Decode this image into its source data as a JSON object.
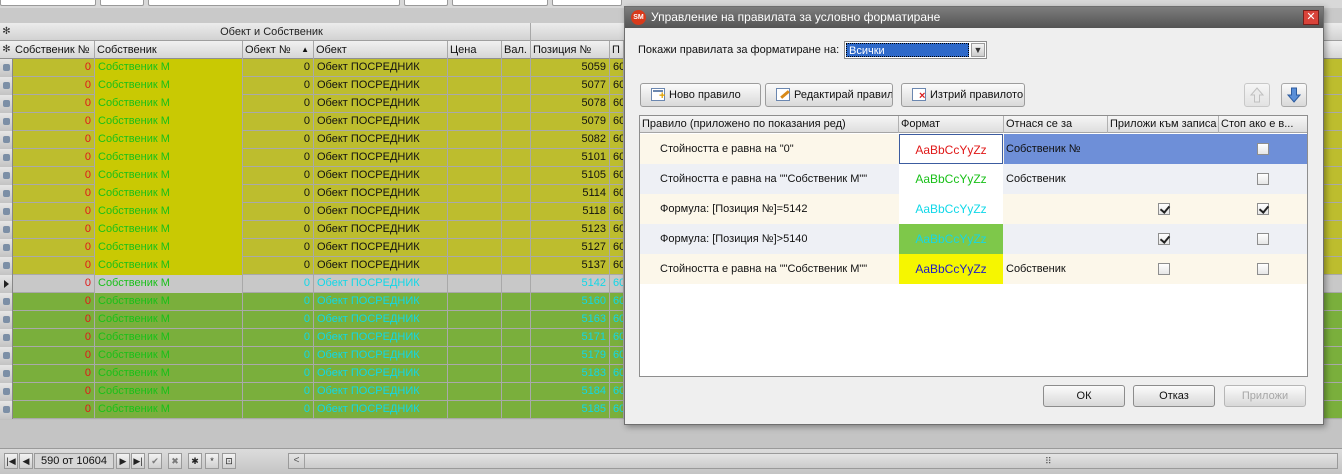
{
  "grid": {
    "group_header": "Обект и Собственик",
    "columns": [
      "Собственик №",
      "Собственик",
      "Обект №",
      "Обект",
      "Цена",
      "Вал.",
      "Позиция №",
      "П"
    ],
    "rows": [
      {
        "owner_no": "0",
        "owner": "Собственик М",
        "object_no": "0",
        "object": "Обект ПОСРЕДНИК",
        "position": "5059",
        "trail": "60",
        "style": "yellow"
      },
      {
        "owner_no": "0",
        "owner": "Собственик М",
        "object_no": "0",
        "object": "Обект ПОСРЕДНИК",
        "position": "5077",
        "trail": "60",
        "style": "yellow"
      },
      {
        "owner_no": "0",
        "owner": "Собственик М",
        "object_no": "0",
        "object": "Обект ПОСРЕДНИК",
        "position": "5078",
        "trail": "60",
        "style": "yellow"
      },
      {
        "owner_no": "0",
        "owner": "Собственик М",
        "object_no": "0",
        "object": "Обект ПОСРЕДНИК",
        "position": "5079",
        "trail": "60",
        "style": "yellow"
      },
      {
        "owner_no": "0",
        "owner": "Собственик М",
        "object_no": "0",
        "object": "Обект ПОСРЕДНИК",
        "position": "5082",
        "trail": "60",
        "style": "yellow"
      },
      {
        "owner_no": "0",
        "owner": "Собственик М",
        "object_no": "0",
        "object": "Обект ПОСРЕДНИК",
        "position": "5101",
        "trail": "60",
        "style": "yellow"
      },
      {
        "owner_no": "0",
        "owner": "Собственик М",
        "object_no": "0",
        "object": "Обект ПОСРЕДНИК",
        "position": "5105",
        "trail": "60",
        "style": "yellow"
      },
      {
        "owner_no": "0",
        "owner": "Собственик М",
        "object_no": "0",
        "object": "Обект ПОСРЕДНИК",
        "position": "5114",
        "trail": "60",
        "style": "yellow"
      },
      {
        "owner_no": "0",
        "owner": "Собственик М",
        "object_no": "0",
        "object": "Обект ПОСРЕДНИК",
        "position": "5118",
        "trail": "60",
        "style": "yellow"
      },
      {
        "owner_no": "0",
        "owner": "Собственик М",
        "object_no": "0",
        "object": "Обект ПОСРЕДНИК",
        "position": "5123",
        "trail": "60",
        "style": "yellow"
      },
      {
        "owner_no": "0",
        "owner": "Собственик М",
        "object_no": "0",
        "object": "Обект ПОСРЕДНИК",
        "position": "5127",
        "trail": "60",
        "style": "yellow"
      },
      {
        "owner_no": "0",
        "owner": "Собственик М",
        "object_no": "0",
        "object": "Обект ПОСРЕДНИК",
        "position": "5137",
        "trail": "60",
        "style": "yellow"
      },
      {
        "owner_no": "0",
        "owner": "Собственик М",
        "object_no": "0",
        "object": "Обект ПОСРЕДНИК",
        "position": "5142",
        "trail": "60",
        "style": "current"
      },
      {
        "owner_no": "0",
        "owner": "Собственик М",
        "object_no": "0",
        "object": "Обект ПОСРЕДНИК",
        "position": "5160",
        "trail": "60",
        "style": "green"
      },
      {
        "owner_no": "0",
        "owner": "Собственик М",
        "object_no": "0",
        "object": "Обект ПОСРЕДНИК",
        "position": "5163",
        "trail": "60",
        "style": "green"
      },
      {
        "owner_no": "0",
        "owner": "Собственик М",
        "object_no": "0",
        "object": "Обект ПОСРЕДНИК",
        "position": "5171",
        "trail": "60",
        "style": "green"
      },
      {
        "owner_no": "0",
        "owner": "Собственик М",
        "object_no": "0",
        "object": "Обект ПОСРЕДНИК",
        "position": "5179",
        "trail": "60",
        "style": "green"
      },
      {
        "owner_no": "0",
        "owner": "Собственик М",
        "object_no": "0",
        "object": "Обект ПОСРЕДНИК",
        "position": "5183",
        "trail": "60",
        "style": "green"
      },
      {
        "owner_no": "0",
        "owner": "Собственик М",
        "object_no": "0",
        "object": "Обект ПОСРЕДНИК",
        "position": "5184",
        "trail": "60",
        "style": "green"
      },
      {
        "owner_no": "0",
        "owner": "Собственик М",
        "object_no": "0",
        "object": "Обект ПОСРЕДНИК",
        "position": "5185",
        "trail": "60",
        "style": "green"
      }
    ]
  },
  "navigator": {
    "counter": "590 от 10604",
    "buttons": [
      "first-icon",
      "prev-icon",
      "next-icon",
      "last-icon",
      "post-icon",
      "cancel-icon",
      "insert-icon",
      "edit-icon",
      "filter-icon"
    ]
  },
  "dialog": {
    "title": "Управление на правилата за условно форматиране",
    "show_rules_label": "Покажи правилата за форматиране на:",
    "show_rules_value": "Всички",
    "buttons": {
      "new_rule": "Ново правило",
      "edit_rule": "Редактирай правилото",
      "delete_rule": "Изтрий правилото",
      "ok": "ОК",
      "cancel": "Отказ",
      "apply": "Приложи"
    },
    "rules_columns": [
      "Правило (приложено по показания ред)",
      "Формат",
      "Отнася се за",
      "Приложи към записа",
      "Стоп ако е в..."
    ],
    "rules": [
      {
        "description": "Стойността е равна на \"0\"",
        "format_sample": "AaBbCcYyZz",
        "applies_to": "Собственик №",
        "apply_to_record": false,
        "stop_if_true": false,
        "selected": true,
        "fmt_color": "#e01818",
        "fmt_bg": "#ffffff"
      },
      {
        "description": "Стойността е равна на \"\"Собственик М\"\"",
        "format_sample": "AaBbCcYyZz",
        "applies_to": "Собственик",
        "apply_to_record": false,
        "stop_if_true": false,
        "selected": false,
        "fmt_color": "#18c018",
        "fmt_bg": "#ffffff"
      },
      {
        "description": "Формула: [Позиция №]=5142",
        "format_sample": "AaBbCcYyZz",
        "applies_to": "",
        "apply_to_record": true,
        "stop_if_true": true,
        "selected": false,
        "fmt_color": "#10d8e8",
        "fmt_bg": "#ffffff"
      },
      {
        "description": "Формула: [Позиция №]>5140",
        "format_sample": "AaBbCcYyZz",
        "applies_to": "",
        "apply_to_record": true,
        "stop_if_true": false,
        "selected": false,
        "fmt_color": "#19d5e5",
        "fmt_bg": "#7ec84a"
      },
      {
        "description": "Стойността е равна на \"\"Собственик М\"\"",
        "format_sample": "AaBbCcYyZz",
        "applies_to": "Собственик",
        "apply_to_record": false,
        "stop_if_true": false,
        "selected": false,
        "fmt_color": "#1c1cc8",
        "fmt_bg": "#f6f600"
      }
    ]
  },
  "colors": {
    "row_yellow_bg": "#bdbd2e",
    "owner_yellow_bg": "#c9c903",
    "row_green_bg": "#7aaf3c",
    "row_current_bg": "#c8c8c8",
    "selected_rule_bg": "#6e8fd8",
    "rule_row_odd_bg": "#fcf7ea",
    "rule_row_even_bg": "#eef0f5"
  }
}
